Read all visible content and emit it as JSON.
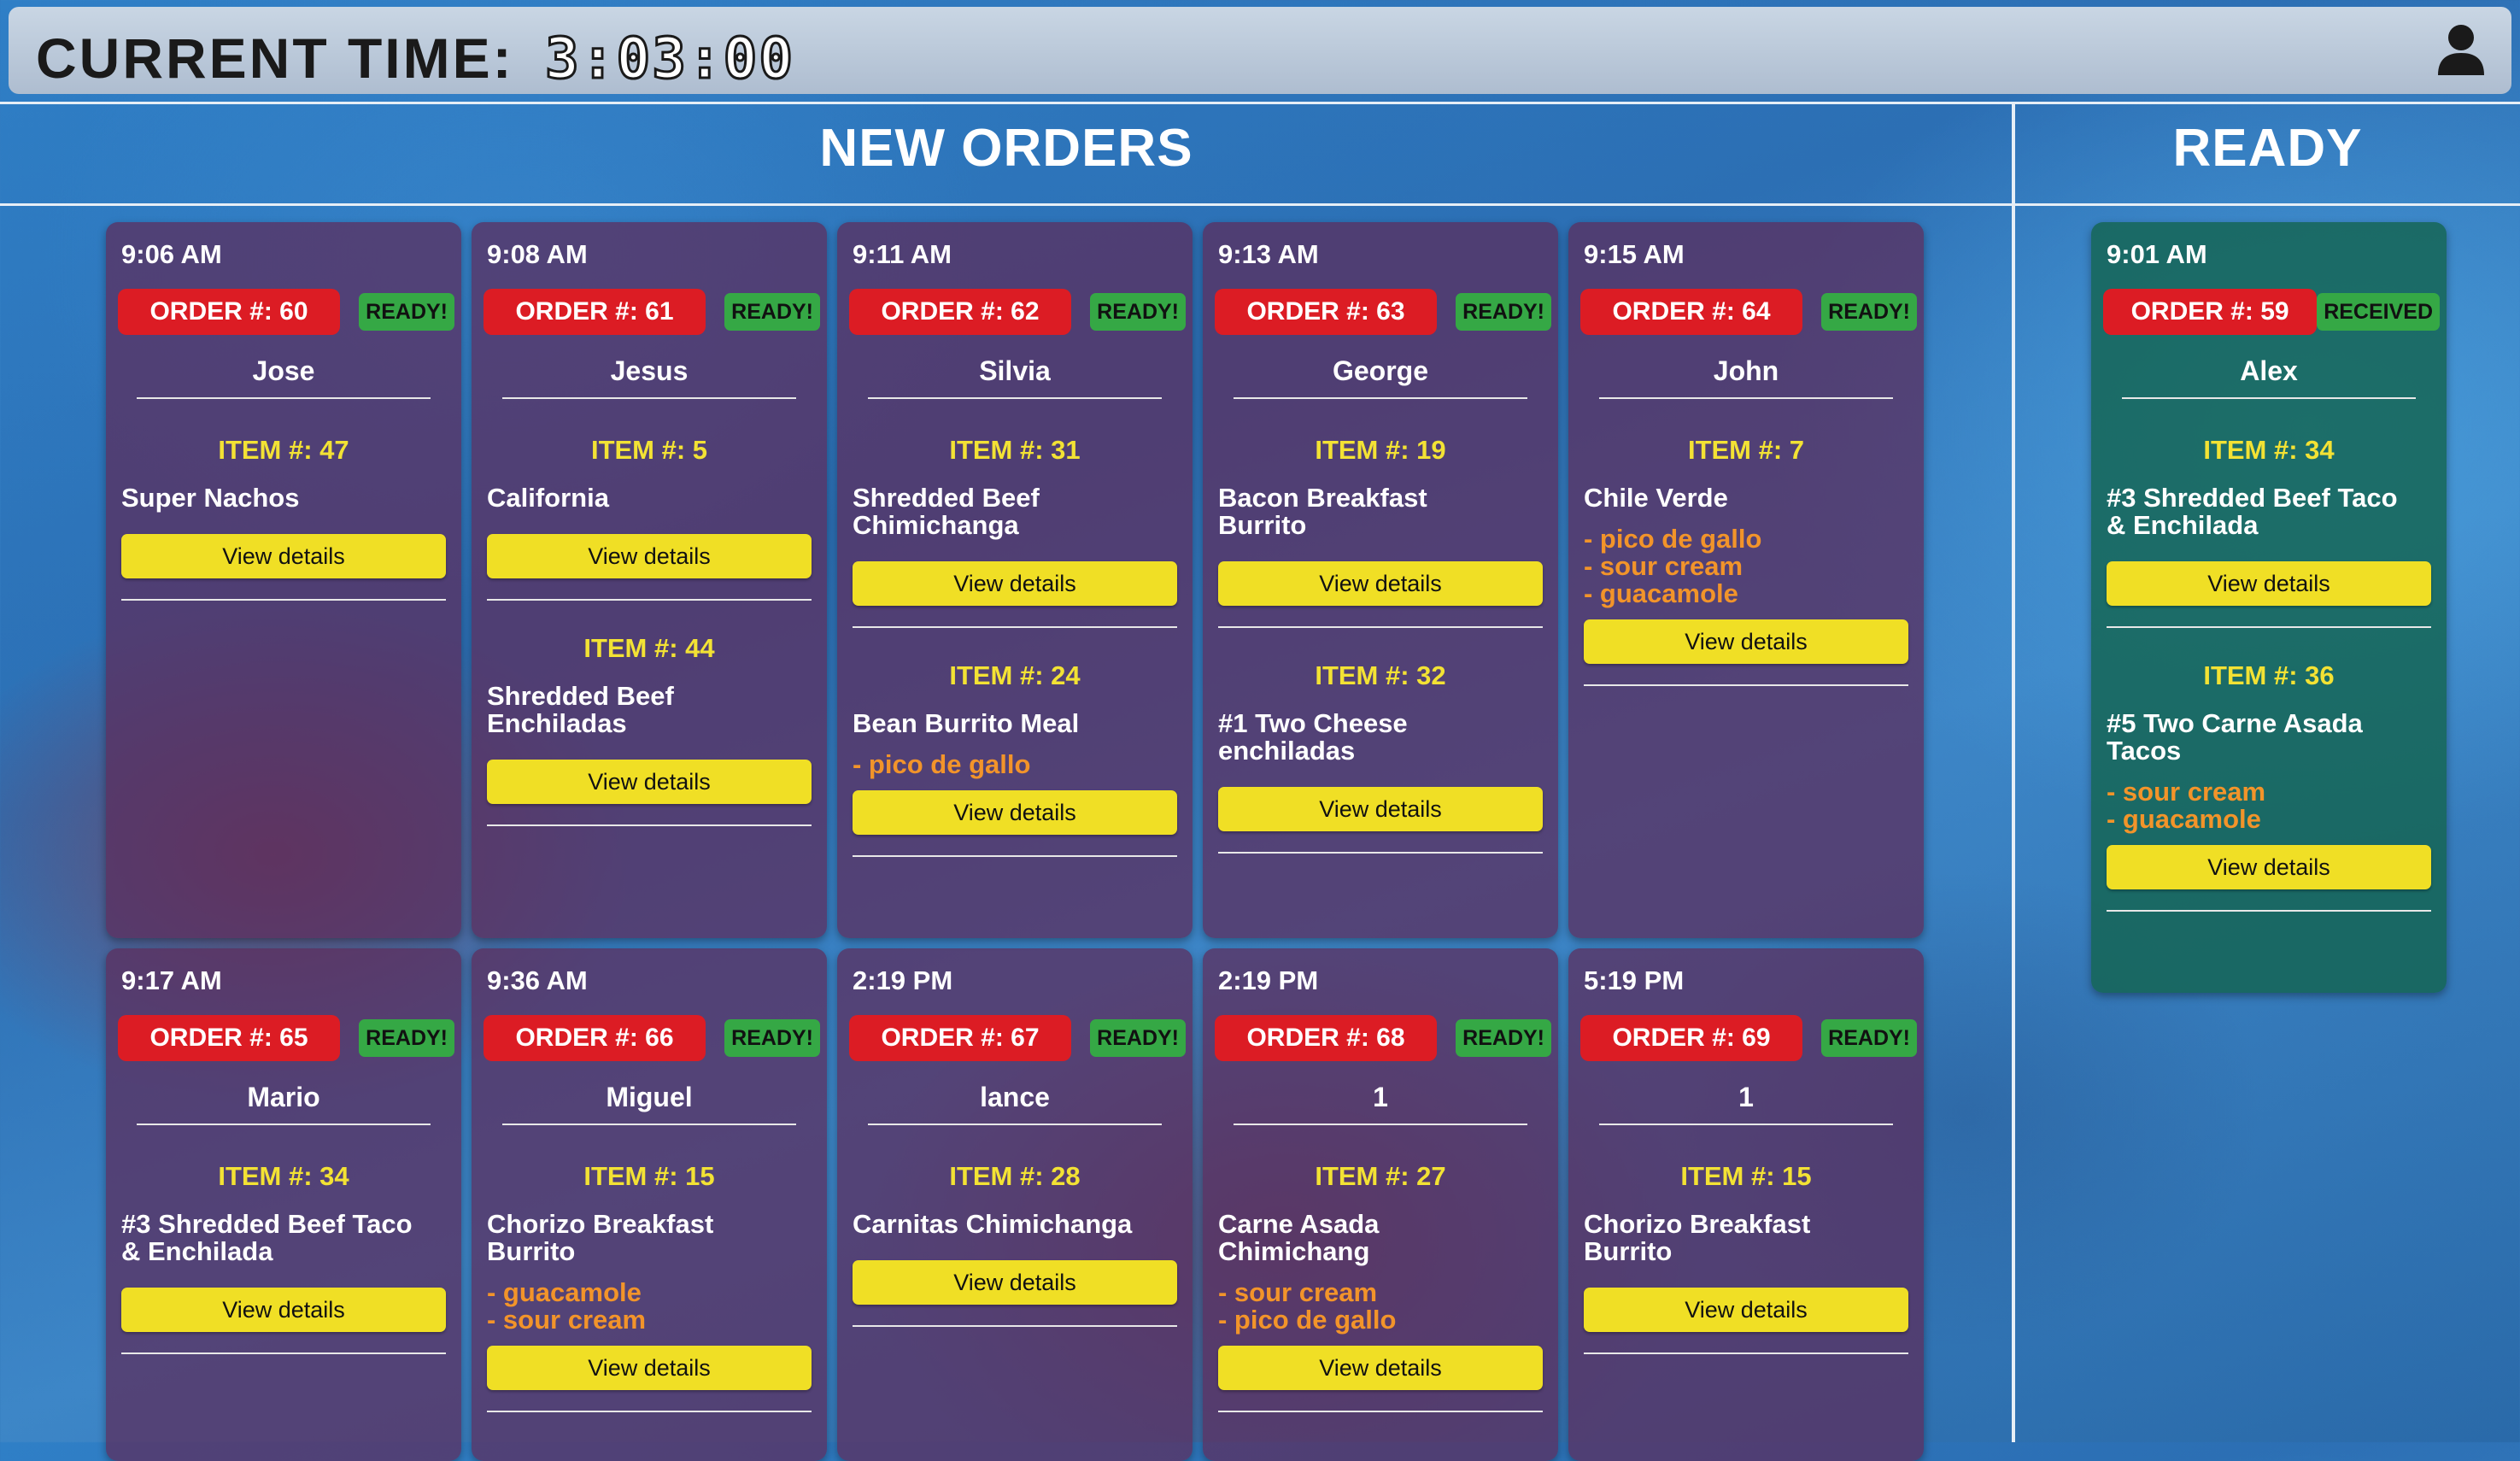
{
  "header": {
    "label": "CURRENT TIME:",
    "time": "3:03:00",
    "user_icon": "user-icon"
  },
  "sections": {
    "new": "NEW ORDERS",
    "ready": "READY"
  },
  "view_label": "View details",
  "new_orders": [
    {
      "time": "9:06 AM",
      "order": "ORDER #: 60",
      "badge": "READY!",
      "customer": "Jose",
      "items": [
        {
          "num": "ITEM #: 47",
          "name": [
            "Super Nachos"
          ],
          "mods": []
        }
      ]
    },
    {
      "time": "9:08 AM",
      "order": "ORDER #: 61",
      "badge": "READY!",
      "customer": "Jesus",
      "items": [
        {
          "num": "ITEM #: 5",
          "name": [
            "California"
          ],
          "mods": []
        },
        {
          "num": "ITEM #: 44",
          "name": [
            "Shredded Beef",
            "Enchiladas"
          ],
          "mods": []
        }
      ]
    },
    {
      "time": "9:11 AM",
      "order": "ORDER #: 62",
      "badge": "READY!",
      "customer": "Silvia",
      "items": [
        {
          "num": "ITEM #: 31",
          "name": [
            "Shredded Beef",
            "Chimichanga"
          ],
          "mods": []
        },
        {
          "num": "ITEM #: 24",
          "name": [
            "Bean Burrito Meal"
          ],
          "mods": [
            "- pico de gallo"
          ]
        }
      ]
    },
    {
      "time": "9:13 AM",
      "order": "ORDER #: 63",
      "badge": "READY!",
      "customer": "George",
      "items": [
        {
          "num": "ITEM #: 19",
          "name": [
            "Bacon Breakfast",
            "Burrito"
          ],
          "mods": []
        },
        {
          "num": "ITEM #: 32",
          "name": [
            "#1 Two Cheese",
            "enchiladas"
          ],
          "mods": []
        }
      ]
    },
    {
      "time": "9:15 AM",
      "order": "ORDER #: 64",
      "badge": "READY!",
      "customer": "John",
      "items": [
        {
          "num": "ITEM #: 7",
          "name": [
            "Chile Verde"
          ],
          "mods": [
            "- pico de gallo",
            "- sour cream",
            "- guacamole"
          ]
        }
      ]
    },
    {
      "time": "9:17 AM",
      "order": "ORDER #: 65",
      "badge": "READY!",
      "customer": "Mario",
      "items": [
        {
          "num": "ITEM #: 34",
          "name": [
            "#3 Shredded Beef Taco",
            "& Enchilada"
          ],
          "mods": []
        }
      ]
    },
    {
      "time": "9:36 AM",
      "order": "ORDER #: 66",
      "badge": "READY!",
      "customer": "Miguel",
      "items": [
        {
          "num": "ITEM #: 15",
          "name": [
            "Chorizo Breakfast",
            "Burrito"
          ],
          "mods": [
            "- guacamole",
            "- sour cream"
          ]
        }
      ]
    },
    {
      "time": "2:19 PM",
      "order": "ORDER #: 67",
      "badge": "READY!",
      "customer": "lance",
      "items": [
        {
          "num": "ITEM #: 28",
          "name": [
            "Carnitas Chimichanga"
          ],
          "mods": []
        }
      ]
    },
    {
      "time": "2:19 PM",
      "order": "ORDER #: 68",
      "badge": "READY!",
      "customer": "1",
      "items": [
        {
          "num": "ITEM #: 27",
          "name": [
            "Carne Asada",
            "Chimichang"
          ],
          "mods": [
            "- sour cream",
            "- pico de gallo"
          ]
        }
      ]
    },
    {
      "time": "5:19 PM",
      "order": "ORDER #: 69",
      "badge": "READY!",
      "customer": "1",
      "items": [
        {
          "num": "ITEM #: 15",
          "name": [
            "Chorizo Breakfast",
            "Burrito"
          ],
          "mods": []
        }
      ]
    }
  ],
  "ready_orders": [
    {
      "time": "9:01 AM",
      "order": "ORDER #: 59",
      "badge": "RECEIVED",
      "customer": "Alex",
      "items": [
        {
          "num": "ITEM #: 34",
          "name": [
            "#3 Shredded Beef Taco",
            "& Enchilada"
          ],
          "mods": []
        },
        {
          "num": "ITEM #: 36",
          "name": [
            "#5 Two Carne Asada",
            "Tacos"
          ],
          "mods": [
            "- sour cream",
            "- guacamole"
          ]
        }
      ]
    }
  ],
  "colors": {
    "order_badge": "#dc1c24",
    "ready_badge": "#35a845",
    "view_button": "#f0df25",
    "item_number": "#f3e234",
    "modifier": "#f2942a"
  }
}
